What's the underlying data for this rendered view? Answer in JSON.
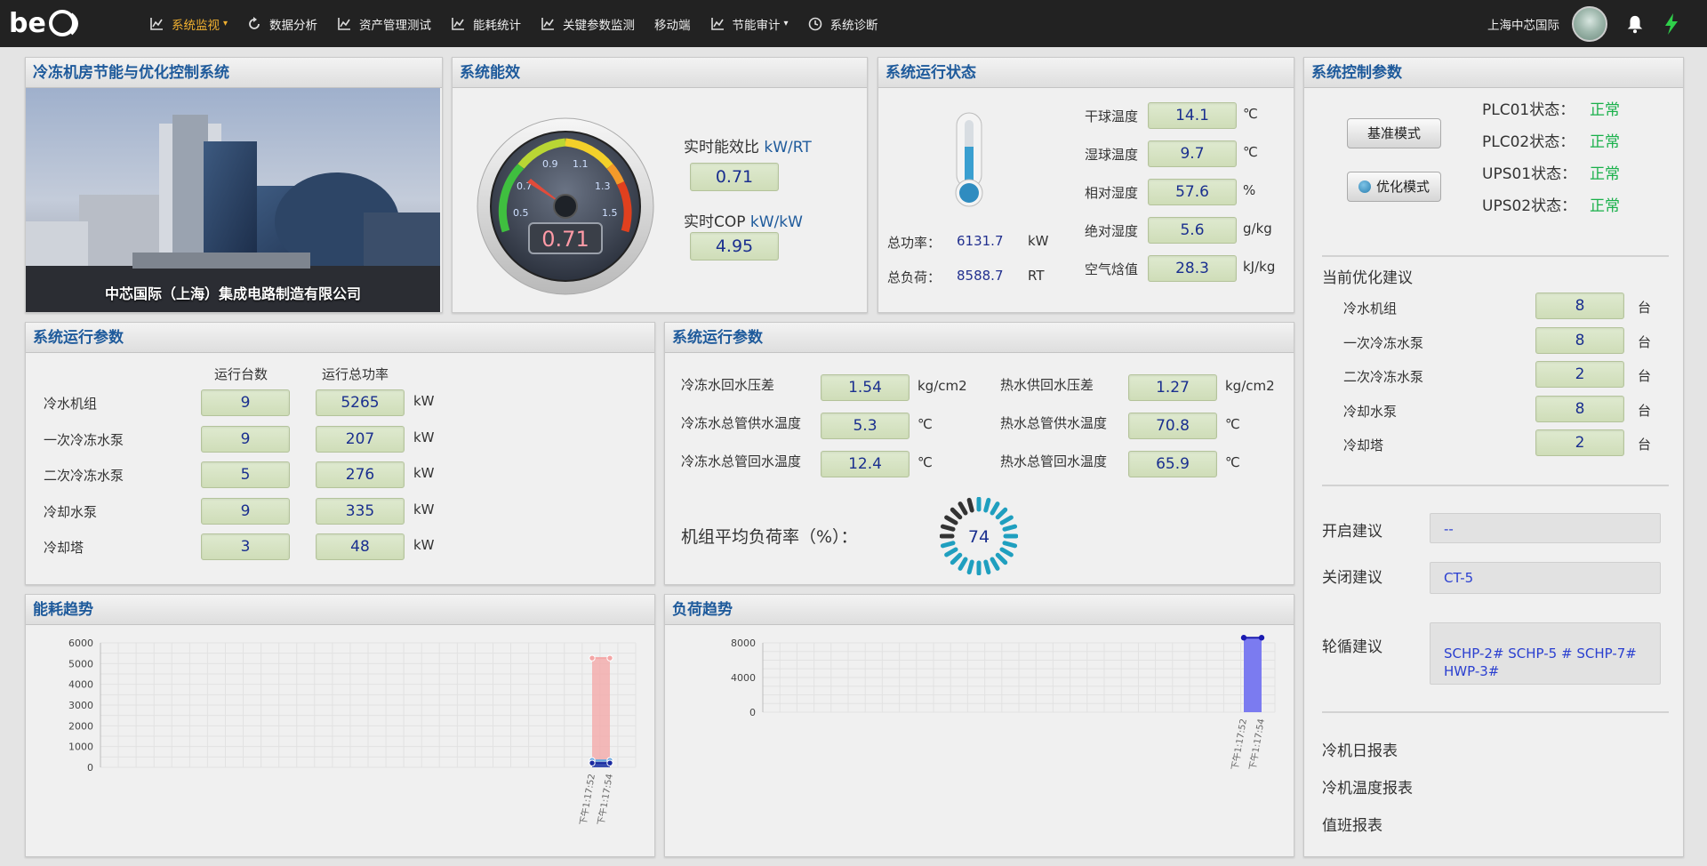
{
  "nav": {
    "items": [
      {
        "label": "系统监视",
        "icon": "chart-line-icon",
        "caret": true,
        "active": true
      },
      {
        "label": "数据分析",
        "icon": "refresh-icon",
        "caret": false,
        "active": false
      },
      {
        "label": "资产管理测试",
        "icon": "chart-line-icon",
        "caret": false,
        "active": false
      },
      {
        "label": "能耗统计",
        "icon": "chart-line-icon",
        "caret": false,
        "active": false
      },
      {
        "label": "关键参数监测",
        "icon": "chart-line-icon",
        "caret": false,
        "active": false
      },
      {
        "label": "移动端",
        "icon": "",
        "caret": false,
        "active": false
      },
      {
        "label": "节能审计",
        "icon": "chart-line-icon",
        "caret": true,
        "active": false
      },
      {
        "label": "系统诊断",
        "icon": "clock-icon",
        "caret": false,
        "active": false
      }
    ],
    "user": "上海中芯国际"
  },
  "panel_intro": {
    "title": "冷冻机房节能与优化控制系统",
    "caption": "中芯国际（上海）集成电路制造有限公司"
  },
  "panel_efficiency": {
    "title": "系统能效",
    "gauge_value": "0.71",
    "gauge_ticks": [
      "0.5",
      "0.7",
      "0.9",
      "1.1",
      "1.3",
      "1.5"
    ],
    "ratio_label": "实时能效比",
    "ratio_unit": "kW/RT",
    "ratio_value": "0.71",
    "cop_label": "实时COP",
    "cop_unit": "kW/kW",
    "cop_value": "4.95"
  },
  "panel_status": {
    "title": "系统运行状态",
    "power_label": "总功率：",
    "power_value": "6131.7",
    "power_unit": "kW",
    "load_label": "总负荷：",
    "load_value": "8588.7",
    "load_unit": "RT",
    "rows": [
      {
        "label": "干球温度",
        "value": "14.1",
        "unit": "℃"
      },
      {
        "label": "湿球温度",
        "value": "9.7",
        "unit": "℃"
      },
      {
        "label": "相对湿度",
        "value": "57.6",
        "unit": "%"
      },
      {
        "label": "绝对湿度",
        "value": "5.6",
        "unit": "g/kg"
      },
      {
        "label": "空气焓值",
        "value": "28.3",
        "unit": "kJ/kg"
      }
    ]
  },
  "panel_control": {
    "title": "系统控制参数",
    "btn_base": "基准模式",
    "btn_opt": "优化模式",
    "states": [
      {
        "label": "PLC01状态：",
        "value": "正常"
      },
      {
        "label": "PLC02状态：",
        "value": "正常"
      },
      {
        "label": "UPS01状态：",
        "value": "正常"
      },
      {
        "label": "UPS02状态：",
        "value": "正常"
      }
    ],
    "advice_title": "当前优化建议",
    "advice": [
      {
        "label": "冷水机组",
        "value": "8",
        "unit": "台"
      },
      {
        "label": "一次冷冻水泵",
        "value": "8",
        "unit": "台"
      },
      {
        "label": "二次冷冻水泵",
        "value": "2",
        "unit": "台"
      },
      {
        "label": "冷却水泵",
        "value": "8",
        "unit": "台"
      },
      {
        "label": "冷却塔",
        "value": "2",
        "unit": "台"
      }
    ],
    "open_label": "开启建议",
    "open_value": "--",
    "close_label": "关闭建议",
    "close_value": "CT-5",
    "rotate_label": "轮循建议",
    "rotate_value": "SCHP-2# SCHP-5 # SCHP-7# HWP-3#",
    "reports": [
      "冷机日报表",
      "冷机温度报表",
      "值班报表"
    ]
  },
  "panel_run1": {
    "title": "系统运行参数",
    "col1": "运行台数",
    "col2": "运行总功率",
    "rows": [
      {
        "label": "冷水机组",
        "count": "9",
        "power": "5265",
        "unit": "kW"
      },
      {
        "label": "一次冷冻水泵",
        "count": "9",
        "power": "207",
        "unit": "kW"
      },
      {
        "label": "二次冷冻水泵",
        "count": "5",
        "power": "276",
        "unit": "kW"
      },
      {
        "label": "冷却水泵",
        "count": "9",
        "power": "335",
        "unit": "kW"
      },
      {
        "label": "冷却塔",
        "count": "3",
        "power": "48",
        "unit": "kW"
      }
    ]
  },
  "panel_run2": {
    "title": "系统运行参数",
    "left": [
      {
        "label": "冷冻水回水压差",
        "value": "1.54",
        "unit": "kg/cm2"
      },
      {
        "label": "冷冻水总管供水温度",
        "value": "5.3",
        "unit": "℃"
      },
      {
        "label": "冷冻水总管回水温度",
        "value": "12.4",
        "unit": "℃"
      }
    ],
    "right": [
      {
        "label": "热水供回水压差",
        "value": "1.27",
        "unit": "kg/cm2"
      },
      {
        "label": "热水总管供水温度",
        "value": "70.8",
        "unit": "℃"
      },
      {
        "label": "热水总管回水温度",
        "value": "65.9",
        "unit": "℃"
      }
    ],
    "load_rate_label": "机组平均负荷率（%）：",
    "load_rate_value": "74"
  },
  "chart_data": [
    {
      "type": "area",
      "title": "能耗趋势",
      "x": [
        "下午1:17:52",
        "下午1:17:54"
      ],
      "series": [
        {
          "values": [
            5265,
            5265
          ],
          "color": "#f4a6a6"
        },
        {
          "values": [
            335,
            335
          ],
          "color": "#6aa8e0"
        },
        {
          "values": [
            207,
            207
          ],
          "color": "#1a2aa0"
        }
      ],
      "yticks": [
        0,
        1000,
        2000,
        3000,
        4000,
        5000,
        6000
      ],
      "ylim": [
        0,
        6000
      ],
      "grid": true
    },
    {
      "type": "bar",
      "title": "负荷趋势",
      "x": [
        "下午1:17:52",
        "下午1:17:54"
      ],
      "series": [
        {
          "values": [
            8588.7,
            8588.7
          ],
          "color": "#7b7bf0"
        }
      ],
      "yticks": [
        0,
        4000,
        8000
      ],
      "ylim": [
        0,
        8000
      ],
      "grid": true
    }
  ]
}
